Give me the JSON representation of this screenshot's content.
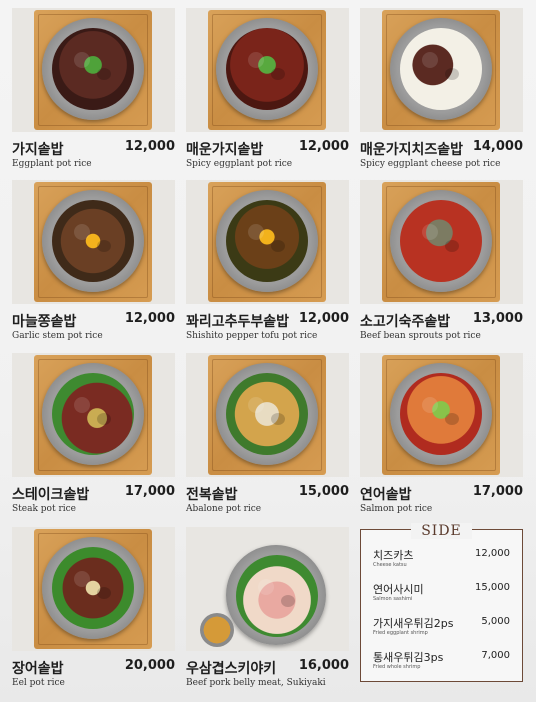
{
  "menu": [
    {
      "name": "가지솥밥",
      "english": "Eggplant pot rice",
      "price": "12,000",
      "food": "f-eggplant"
    },
    {
      "name": "매운가지솥밥",
      "english": "Spicy eggplant pot rice",
      "price": "12,000",
      "food": "f-spicy"
    },
    {
      "name": "매운가지치즈솥밥",
      "english": "Spicy eggplant cheese pot rice",
      "price": "14,000",
      "food": "f-cheese"
    },
    {
      "name": "마늘쫑솥밥",
      "english": "Garlic stem pot rice",
      "price": "12,000",
      "food": "f-garlic"
    },
    {
      "name": "꽈리고추두부솥밥",
      "english": "Shishito pepper tofu pot rice",
      "price": "12,000",
      "food": "f-tofu"
    },
    {
      "name": "소고기숙주솥밥",
      "english": "Beef bean sprouts pot rice",
      "price": "13,000",
      "food": "f-beef"
    },
    {
      "name": "스테이크솥밥",
      "english": "Steak pot rice",
      "price": "17,000",
      "food": "f-steak"
    },
    {
      "name": "전복솥밥",
      "english": "Abalone pot rice",
      "price": "15,000",
      "food": "f-abalone"
    },
    {
      "name": "연어솥밥",
      "english": "Salmon pot rice",
      "price": "17,000",
      "food": "f-salmon"
    },
    {
      "name": "장어솥밥",
      "english": "Eel pot rice",
      "price": "20,000",
      "food": "f-eel"
    },
    {
      "name": "우삼겹스키야키",
      "english": "Beef pork belly meat, Sukiyaki",
      "price": "16,000",
      "food": "f-sukiyaki"
    }
  ],
  "side": {
    "title": "SIDE",
    "items": [
      {
        "name": "치즈카츠",
        "english": "Cheese katsu",
        "price": "12,000"
      },
      {
        "name": "연어사시미",
        "english": "Salmon sashimi",
        "price": "15,000"
      },
      {
        "name": "가지새우튀김2ps",
        "english": "Fried eggplant shrimp",
        "price": "5,000"
      },
      {
        "name": "통새우튀김3ps",
        "english": "Fried whole shrimp",
        "price": "7,000"
      }
    ]
  }
}
